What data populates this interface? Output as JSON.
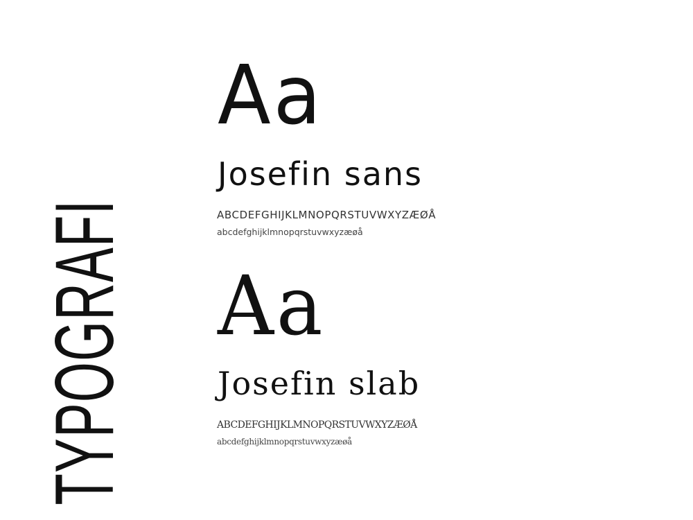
{
  "title": "TYPOGRAFI",
  "fonts": [
    {
      "sample": "Aa",
      "name": "Josefin sans",
      "uppercase": "ABCDEFGHIJKLMNOPQRSTUVWXYZÆØÅ",
      "lowercase": "abcdefghijklmnopqrstuvwxyzæøå"
    },
    {
      "sample": "Aa",
      "name": "Josefin slab",
      "uppercase": "ABCDEFGHIJKLMNOPQRSTUVWXYZÆØÅ",
      "lowercase": "abcdefghijklmnopqrstuvwxyzæøå"
    }
  ]
}
